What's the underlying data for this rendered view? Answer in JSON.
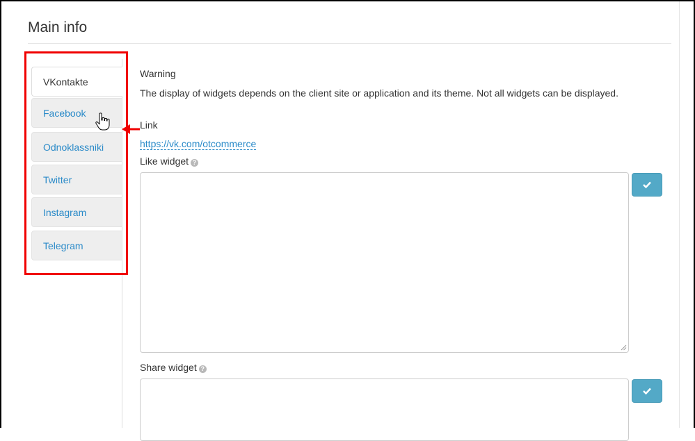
{
  "header": {
    "title": "Main info"
  },
  "tabs": [
    {
      "label": "VKontakte",
      "active": true
    },
    {
      "label": "Facebook",
      "active": false
    },
    {
      "label": "Odnoklassniki",
      "active": false
    },
    {
      "label": "Twitter",
      "active": false
    },
    {
      "label": "Instagram",
      "active": false
    },
    {
      "label": "Telegram",
      "active": false
    }
  ],
  "content": {
    "warning_label": "Warning",
    "warning_text": "The display of widgets depends on the client site or application and its theme. Not all widgets can be displayed.",
    "link_label": "Link",
    "link_url": "https://vk.com/otcommerce",
    "like_widget_label": "Like widget",
    "like_widget_value": "",
    "share_widget_label": "Share widget",
    "share_widget_value": ""
  },
  "icons": {
    "help": "question-circle-icon",
    "confirm": "checkmark-icon",
    "cursor": "hand-pointer-icon"
  },
  "colors": {
    "link": "#2a8ac8",
    "tab_bg": "#eeeeee",
    "highlight": "#f00000",
    "button": "#53a9c7"
  }
}
